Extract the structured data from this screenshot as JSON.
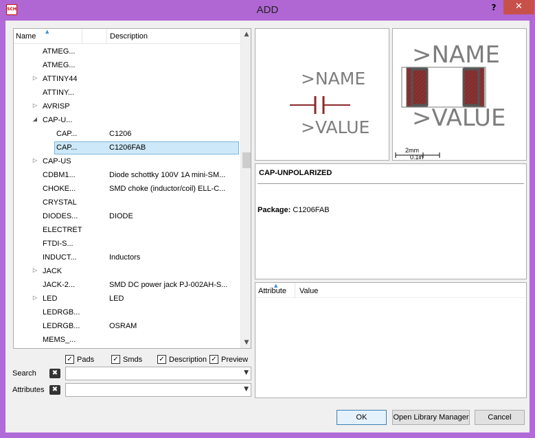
{
  "window": {
    "title": "ADD",
    "help_label": "?",
    "close_label": "✕",
    "icon_text": "SCH"
  },
  "tree": {
    "columns": {
      "name": "Name",
      "description": "Description"
    },
    "rows": [
      {
        "name": "ATMEG...",
        "desc": "",
        "indent": 0,
        "expander": ""
      },
      {
        "name": "ATMEG...",
        "desc": "",
        "indent": 0,
        "expander": ""
      },
      {
        "name": "ATTINY44",
        "desc": "",
        "indent": 0,
        "expander": "▷"
      },
      {
        "name": "ATTINY...",
        "desc": "",
        "indent": 0,
        "expander": ""
      },
      {
        "name": "AVRISP",
        "desc": "",
        "indent": 0,
        "expander": "▷"
      },
      {
        "name": "CAP-U...",
        "desc": "",
        "indent": 0,
        "expander": "◢"
      },
      {
        "name": "CAP...",
        "desc": "C1206",
        "indent": 1,
        "expander": ""
      },
      {
        "name": "CAP...",
        "desc": "C1206FAB",
        "indent": 1,
        "expander": "",
        "selected": true
      },
      {
        "name": "CAP-US",
        "desc": "",
        "indent": 0,
        "expander": "▷"
      },
      {
        "name": "CDBM1...",
        "desc": "Diode schottky 100V 1A mini-SM...",
        "indent": 0,
        "expander": ""
      },
      {
        "name": "CHOKE...",
        "desc": "SMD choke (inductor/coil) ELL-C...",
        "indent": 0,
        "expander": ""
      },
      {
        "name": "CRYSTAL",
        "desc": "",
        "indent": 0,
        "expander": ""
      },
      {
        "name": "DIODES...",
        "desc": "DIODE",
        "indent": 0,
        "expander": ""
      },
      {
        "name": "ELECTRET",
        "desc": "",
        "indent": 0,
        "expander": ""
      },
      {
        "name": "FTDI-S...",
        "desc": "",
        "indent": 0,
        "expander": ""
      },
      {
        "name": "INDUCT...",
        "desc": "Inductors",
        "indent": 0,
        "expander": ""
      },
      {
        "name": "JACK",
        "desc": "",
        "indent": 0,
        "expander": "▷"
      },
      {
        "name": "JACK-2...",
        "desc": "SMD DC power jack PJ-002AH-S...",
        "indent": 0,
        "expander": ""
      },
      {
        "name": "LED",
        "desc": "LED",
        "indent": 0,
        "expander": "▷"
      },
      {
        "name": "LEDRGB...",
        "desc": "",
        "indent": 0,
        "expander": ""
      },
      {
        "name": "LEDRGB...",
        "desc": "OSRAM",
        "indent": 0,
        "expander": ""
      },
      {
        "name": "MEMS_...",
        "desc": "",
        "indent": 0,
        "expander": ""
      }
    ]
  },
  "checkboxes": [
    {
      "label": "Pads",
      "checked": true
    },
    {
      "label": "Smds",
      "checked": true
    },
    {
      "label": "Description",
      "checked": true
    },
    {
      "label": "Preview",
      "checked": true
    }
  ],
  "search": {
    "label": "Search",
    "value": ""
  },
  "attributes": {
    "label": "Attributes",
    "value": ""
  },
  "symbol_preview": {
    "name": ">NAME",
    "value": ">VALUE"
  },
  "package_preview": {
    "name": ">NAME",
    "value": ">VALUE",
    "scale_mm": "2mm",
    "scale_in": "0.1in"
  },
  "info": {
    "title": "CAP-UNPOLARIZED",
    "package_label": "Package:",
    "package_value": "C1206FAB"
  },
  "attr_table": {
    "columns": {
      "attribute": "Attribute",
      "value": "Value"
    }
  },
  "buttons": {
    "ok": "OK",
    "open_library_manager": "Open Library Manager",
    "cancel": "Cancel"
  },
  "colors": {
    "accent": "#b067d4",
    "close": "#c7504b",
    "selection": "#cde8f8",
    "pad": "#8b2a2a"
  }
}
